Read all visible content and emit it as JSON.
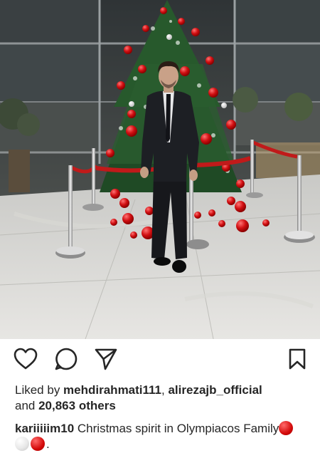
{
  "post": {
    "image_alt": "Man in a dark suit standing in front of a decorated Christmas tree in a marble lobby",
    "actions": [
      {
        "name": "like",
        "icon": "heart-icon"
      },
      {
        "name": "comment",
        "icon": "comment-icon"
      },
      {
        "name": "share",
        "icon": "paper-plane-icon"
      },
      {
        "name": "save",
        "icon": "bookmark-icon"
      }
    ],
    "likes": {
      "prefix": "Liked by ",
      "user1": "mehdirahmati111",
      "separator": ", ",
      "user2": "alirezajb_official",
      "and_text": "and ",
      "count": "20,863 others"
    },
    "caption": {
      "username": "kariiiiim10",
      "text": " Christmas spirit in Olympiacos Family",
      "emoji": [
        "red-circle",
        "white-circle",
        "red-circle"
      ],
      "end": "."
    }
  },
  "colors": {
    "text": "#262626",
    "ornament_red": "#d40a0a",
    "icon": "#262626"
  }
}
